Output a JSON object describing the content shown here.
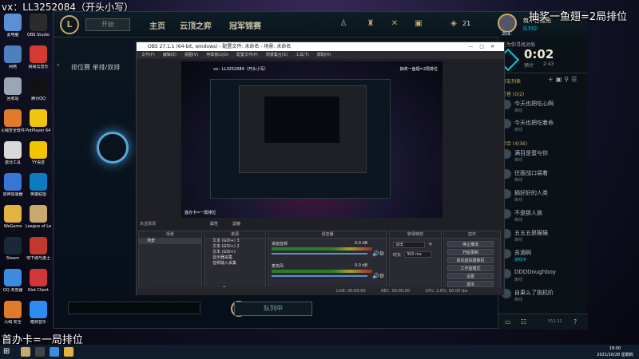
{
  "overlay": {
    "top_left": "vx：LL3252084（开头小写）",
    "top_right": "抽奖一鱼翅=2局排位",
    "bottom_left": "首办卡=一局排位"
  },
  "desktop_icons": [
    {
      "label": "此电脑",
      "color": "#5b8fd6"
    },
    {
      "label": "网络",
      "color": "#4e7fbf"
    },
    {
      "label": "回收站",
      "color": "#9aa6b4"
    },
    {
      "label": "火绒安全软件",
      "color": "#e27a2c"
    },
    {
      "label": "激活工具",
      "color": "#d9d9d9"
    },
    {
      "label": "雷神加速器",
      "color": "#3875d7"
    },
    {
      "label": "WeGame",
      "color": "#e3b341"
    },
    {
      "label": "Steam",
      "color": "#1b2838"
    },
    {
      "label": "QQ 浏览器",
      "color": "#3b8be0"
    },
    {
      "label": "火绒·安全",
      "color": "#e07b2a"
    }
  ],
  "desktop_icons_col2": [
    {
      "label": "OBS Studio",
      "color": "#2b2b2b"
    },
    {
      "label": "网易云音乐",
      "color": "#d43c33"
    },
    {
      "label": "腾讯QQ",
      "color": "#111"
    },
    {
      "label": "PotPlayer 64 bit",
      "color": "#f1c40f"
    },
    {
      "label": "YY语音",
      "color": "#f5c400"
    },
    {
      "label": "英雄联盟",
      "color": "#0a7cbf"
    },
    {
      "label": "League of Legends",
      "color": "#c8aa6e"
    },
    {
      "label": "地下城与勇士",
      "color": "#c0392b"
    },
    {
      "label": "Riot Client",
      "color": "#d13639"
    },
    {
      "label": "酷狗音乐",
      "color": "#2d8cf0"
    }
  ],
  "lol": {
    "play_label": "开始",
    "nav": [
      "主页",
      "云顶之弈",
      "冠军锦赛"
    ],
    "queue_title": "排位赛 单排/双排",
    "queue_button": "队列中",
    "coins": "21",
    "level": "219",
    "summoner_name": "筑不在擂饱",
    "summoner_status": "队列中",
    "queue_label": "在为你寻找对局",
    "timer": "0:02",
    "estimate_label": "预计",
    "estimate_time": "2:43",
    "friends_header": "好友列表",
    "group1": "老爸 (0/2)",
    "group2": "综合 (4/36)",
    "friends": [
      {
        "name": "今天也把吃心啊",
        "status": "离线"
      },
      {
        "name": "今天也把吃着命",
        "status": "离线"
      },
      {
        "name": "满目是蛋与你",
        "status": "离线"
      },
      {
        "name": "往面战口袋着",
        "status": "离线"
      },
      {
        "name": "摘好好的人类",
        "status": "离线"
      },
      {
        "name": "不是那人族",
        "status": "离线"
      },
      {
        "name": "五五五是猫猫",
        "status": "离线"
      },
      {
        "name": "苏酒啊",
        "status": "游戏中"
      },
      {
        "name": "DDDDoughboy",
        "status": "离线"
      },
      {
        "name": "自果么了挑机阶",
        "status": "离线"
      }
    ]
  },
  "obs": {
    "title": "OBS 27.1.1 (64-bit, windows) - 配置文件: 未命名 - 场景: 未命名",
    "menu": [
      "文件(F)",
      "编辑(E)",
      "视图(V)",
      "停靠窗口(D)",
      "配置文件(P)",
      "场景集合(S)",
      "工具(T)",
      "帮助(H)"
    ],
    "no_source": "未选择源",
    "props": "属性",
    "filters": "滤镜",
    "docks": {
      "scenes": "场景",
      "sources": "来源",
      "mixer": "混音器",
      "transitions": "转场特效",
      "controls": "控件"
    },
    "scene_item": "场景",
    "sources": [
      "文本 (GDI+) 3",
      "文本 (GDI+) 2",
      "文本 (GDI+)",
      "显示器采集",
      "音频输入采集"
    ],
    "mixer": [
      {
        "name": "桌面音频",
        "db": "0.0 dB"
      },
      {
        "name": "麦克风",
        "db": "0.0 dB"
      }
    ],
    "transition": "淡出",
    "duration_label": "时长",
    "duration_value": "300 ms",
    "controls": [
      "停止推流",
      "开始录制",
      "启动虚拟摄像机",
      "工作室模式",
      "设置",
      "退出"
    ],
    "status": {
      "live": "LIVE: 00:00:00",
      "rec": "REC: 00:00:00",
      "cpu": "CPU: 2.0%, 60.00 fps"
    }
  },
  "taskbar": {
    "time": "18:00",
    "date": "2021/10/28 星期四"
  }
}
